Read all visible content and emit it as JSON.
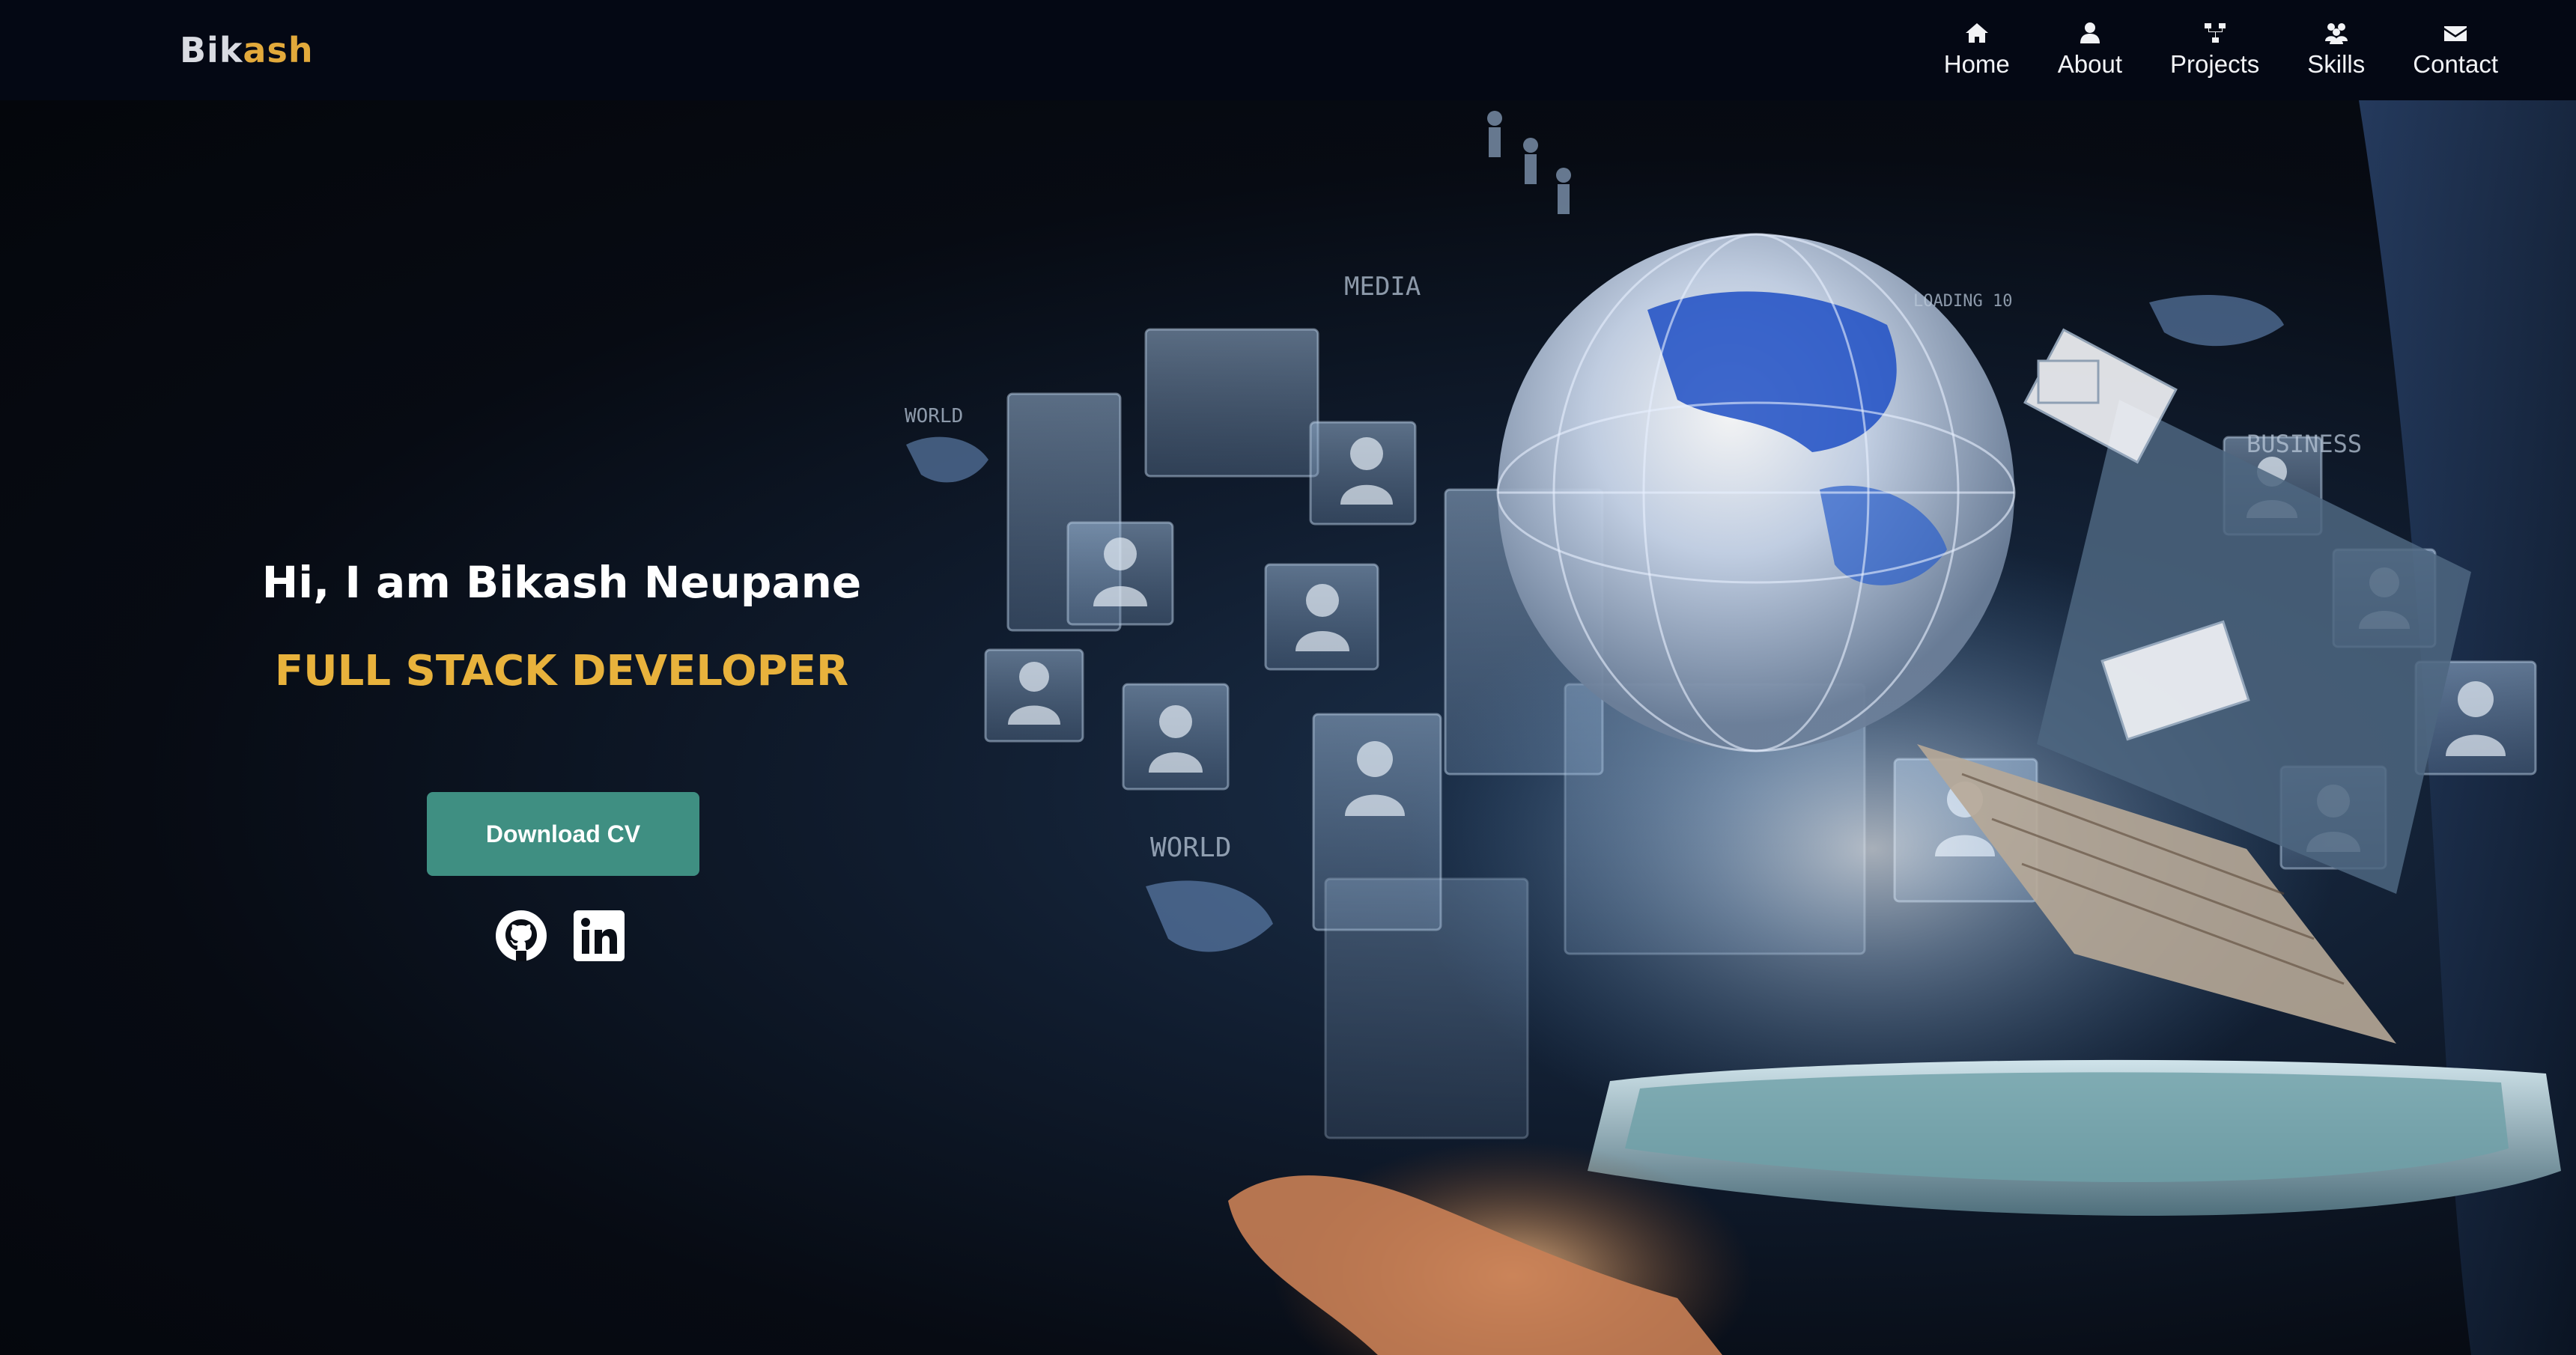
{
  "brand": {
    "prefix": "Bik",
    "accent": "ash"
  },
  "nav": [
    {
      "label": "Home",
      "icon": "home-icon"
    },
    {
      "label": "About",
      "icon": "user-icon"
    },
    {
      "label": "Projects",
      "icon": "sitemap-icon"
    },
    {
      "label": "Skills",
      "icon": "people-icon"
    },
    {
      "label": "Contact",
      "icon": "envelope-icon"
    }
  ],
  "hero": {
    "greeting": "Hi, I am Bikash Neupane",
    "role": "FULL STACK DEVELOPER",
    "cv_button": "Download CV",
    "socials": [
      {
        "icon": "github-icon"
      },
      {
        "icon": "linkedin-icon"
      }
    ],
    "image_words": [
      "WORLD",
      "MEDIA",
      "LOADING 10",
      "BUSINESS",
      "WORLD"
    ]
  },
  "colors": {
    "navbar_bg": "#040814",
    "brand_accent": "#e2a93b",
    "role_text": "#e8b23c",
    "button_bg": "#3f8f82"
  }
}
